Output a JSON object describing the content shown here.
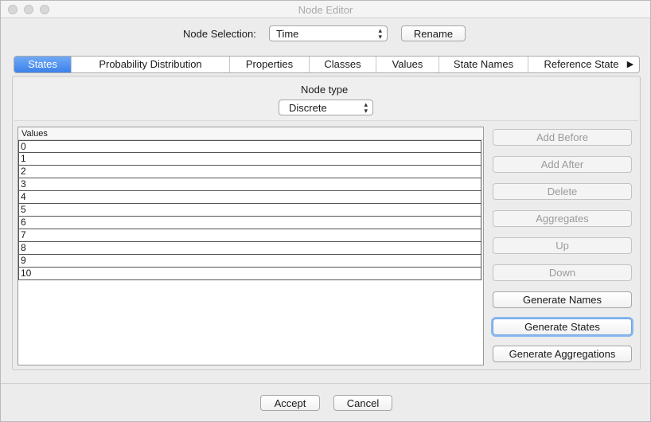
{
  "window": {
    "title": "Node Editor"
  },
  "node_selection": {
    "label": "Node Selection:",
    "value": "Time",
    "rename_label": "Rename"
  },
  "tabs": [
    {
      "label": "States"
    },
    {
      "label": "Probability Distribution"
    },
    {
      "label": "Properties"
    },
    {
      "label": "Classes"
    },
    {
      "label": "Values"
    },
    {
      "label": "State Names"
    },
    {
      "label": "Reference State"
    }
  ],
  "active_tab": "States",
  "node_type": {
    "label": "Node type",
    "value": "Discrete"
  },
  "values_table": {
    "header": "Values",
    "rows": [
      "0",
      "1",
      "2",
      "3",
      "4",
      "5",
      "6",
      "7",
      "8",
      "9",
      "10"
    ]
  },
  "side_buttons": {
    "add_before": "Add Before",
    "add_after": "Add After",
    "delete": "Delete",
    "aggregates": "Aggregates",
    "up": "Up",
    "down": "Down",
    "generate_names": "Generate Names",
    "generate_states": "Generate States",
    "generate_aggregations": "Generate Aggregations"
  },
  "footer": {
    "accept": "Accept",
    "cancel": "Cancel"
  }
}
